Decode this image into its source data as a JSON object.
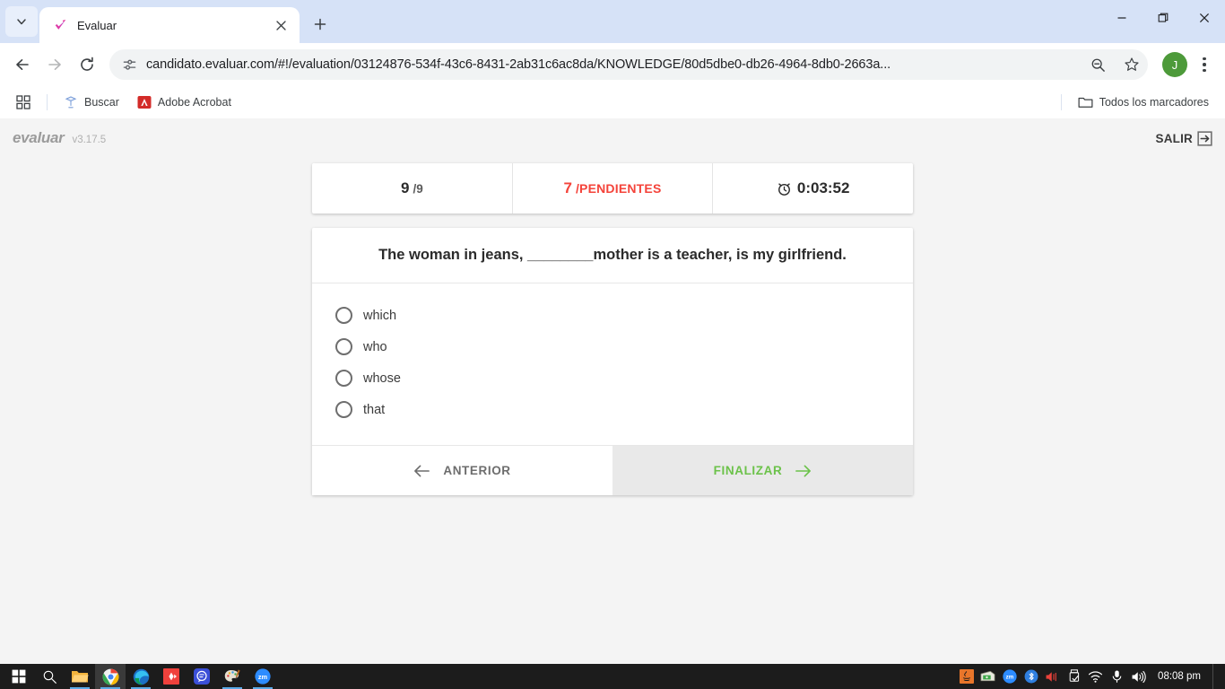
{
  "browser": {
    "tab": {
      "title": "Evaluar",
      "favicon": "evaluar-check-favicon"
    },
    "new_tab_label": "+",
    "tab_list_icon": "chevron-down-icon",
    "window_controls": {
      "minimize": "minimize-icon",
      "maximize": "maximize-icon",
      "close": "close-icon"
    },
    "nav": {
      "back": "back-arrow-icon",
      "forward": "forward-arrow-icon",
      "reload": "reload-icon"
    },
    "omnibox": {
      "site_icon": "site-settings-icon",
      "url": "candidato.evaluar.com/#!/evaluation/03124876-534f-43c6-8431-2ab31c6ac8da/KNOWLEDGE/80d5dbe0-db26-4964-8db0-2663a...",
      "zoom_icon": "zoom-out-icon",
      "bookmark_icon": "star-icon"
    },
    "profile": {
      "initial": "J",
      "color": "#4d9a3a"
    },
    "menu_icon": "kebab-menu-icon",
    "bookmarks": {
      "apps_icon": "apps-grid-icon",
      "items": [
        {
          "label": "Buscar",
          "icon": "search-engine-icon"
        },
        {
          "label": "Adobe Acrobat",
          "icon": "adobe-acrobat-icon"
        }
      ],
      "all_bookmarks": {
        "label": "Todos los marcadores",
        "icon": "folder-icon"
      }
    }
  },
  "app": {
    "logo": "evaluar",
    "version": "v3.17.5",
    "logout": {
      "label": "SALIR",
      "icon": "logout-icon"
    },
    "stats": {
      "progress_current": "9",
      "progress_total": "/9",
      "pending_count": "7",
      "pending_label": "/PENDIENTES",
      "pending_color": "#f4433a",
      "timer_icon": "alarm-clock-icon",
      "timer": "0:03:52"
    },
    "question": {
      "text": "The woman in jeans, ________mother is a teacher, is my girlfriend.",
      "options": [
        {
          "label": "which",
          "selected": false
        },
        {
          "label": "who",
          "selected": false
        },
        {
          "label": "whose",
          "selected": false
        },
        {
          "label": "that",
          "selected": false
        }
      ]
    },
    "footer": {
      "prev_label": "ANTERIOR",
      "prev_icon": "arrow-left-icon",
      "finish_label": "FINALIZAR",
      "finish_icon": "arrow-right-icon",
      "finish_color": "#6cc24a"
    }
  },
  "taskbar": {
    "start_icon": "windows-start-icon",
    "search_icon": "search-icon",
    "apps": [
      {
        "name": "file-explorer-icon"
      },
      {
        "name": "google-chrome-icon"
      },
      {
        "name": "microsoft-edge-icon"
      },
      {
        "name": "red-app-icon"
      },
      {
        "name": "blue-chat-app-icon"
      },
      {
        "name": "paint-app-icon"
      },
      {
        "name": "zoom-app-icon"
      }
    ],
    "tray": [
      {
        "name": "java-icon"
      },
      {
        "name": "cash-drawer-icon"
      },
      {
        "name": "zoom-tray-icon"
      },
      {
        "name": "bluetooth-icon"
      },
      {
        "name": "volume-muted-icon"
      },
      {
        "name": "usb-drive-icon"
      },
      {
        "name": "wifi-icon"
      },
      {
        "name": "microphone-icon"
      },
      {
        "name": "speaker-icon"
      }
    ],
    "clock": "08:08 pm"
  }
}
